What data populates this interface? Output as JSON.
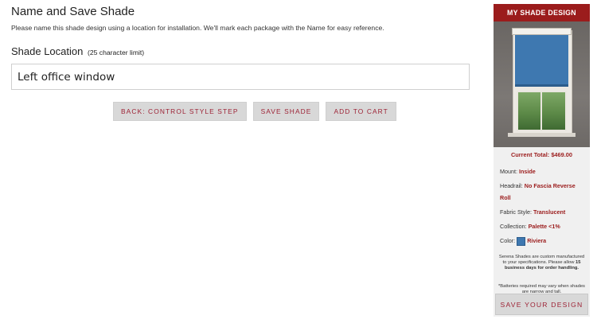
{
  "form": {
    "title": "Name and Save Shade",
    "description": "Please name this shade design using a location for installation. We'll mark each package with the Name for easy reference.",
    "location_label": "Shade Location",
    "location_note": "(25 character limit)",
    "location_value": "Left office window"
  },
  "actions": {
    "back_label": "BACK: CONTROL STYLE STEP",
    "save_label": "SAVE SHADE",
    "cart_label": "ADD TO CART"
  },
  "sidebar": {
    "header": "MY SHADE DESIGN",
    "total": "Current Total: $469.00",
    "specs": [
      {
        "label": "Mount:",
        "value": "Inside"
      },
      {
        "label": "Headrail:",
        "value": "No Fascia Reverse Roll"
      },
      {
        "label": "Fabric Style:",
        "value": "Translucent"
      },
      {
        "label": "Collection:",
        "value": "Palette <1%"
      },
      {
        "label": "Color:",
        "value": "Riviera"
      }
    ],
    "swatch_color": "#3e78b0",
    "notice_text": "Serena Shades are custom manufactured to your specifications. Please allow",
    "notice_bold": "15 business days for order handling.",
    "battery_note": "*Batteries required may vary when shades are narrow and tall.",
    "save_design_label": "SAVE YOUR DESIGN"
  },
  "colors": {
    "accent": "#9b1c1c",
    "button_text": "#9d2235",
    "button_bg": "#d8d8d8"
  }
}
